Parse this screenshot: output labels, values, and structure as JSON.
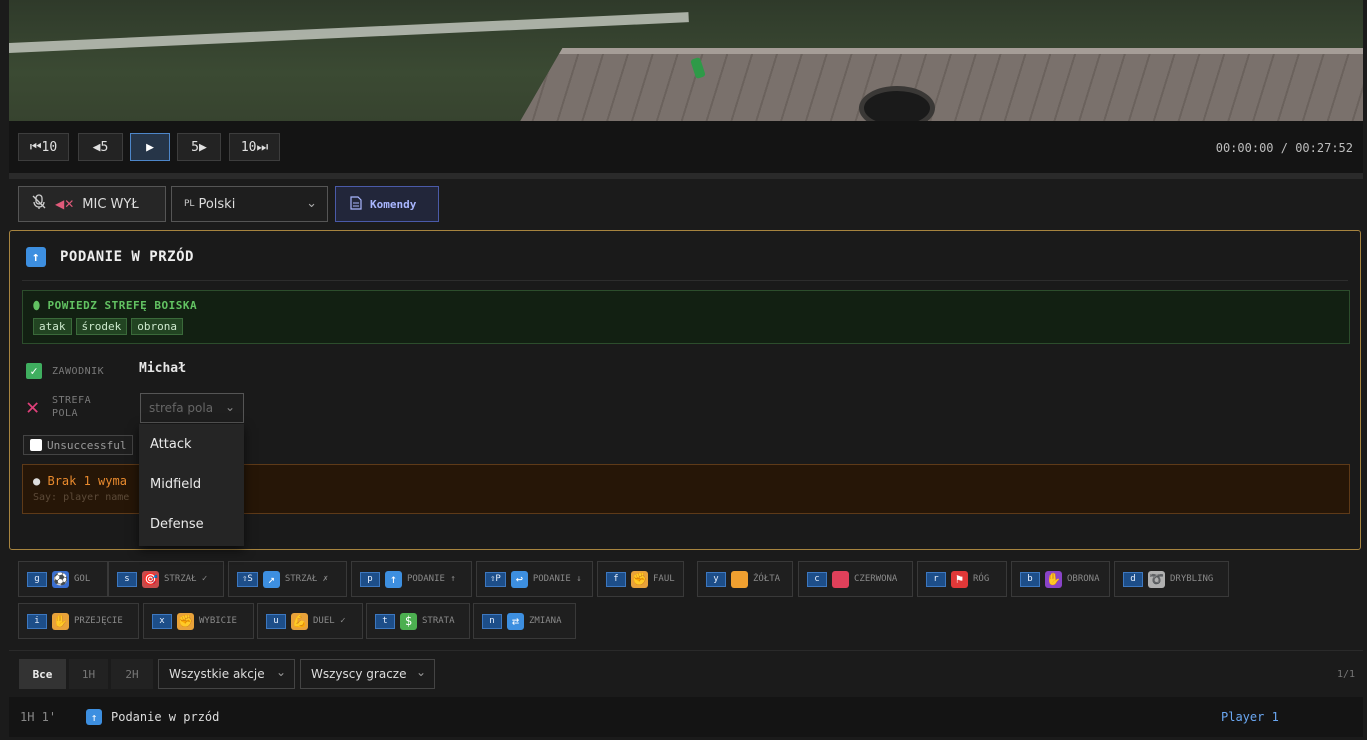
{
  "controls": {
    "back10": "⏮10",
    "back5": "◀5",
    "play": "▶",
    "fwd5": "5▶",
    "fwd10": "10⏭",
    "timecode": "00:00:00 / 00:27:52"
  },
  "toolbar": {
    "mic_label": "MIC WYŁ",
    "lang_code": "PL",
    "lang_value": "Polski",
    "commands_label": "Komendy"
  },
  "action_panel": {
    "title": "PODANIE W PRZÓD",
    "hint_title": "POWIEDZ STREFĘ BOISKA",
    "hint_chips": [
      "atak",
      "środek",
      "obrona"
    ],
    "player_label": "ZAWODNIK",
    "player_value": "Michał",
    "zone_label_1": "STREFA",
    "zone_label_2": "POLA",
    "zone_placeholder": "strefa pola",
    "unsuccessful_label": "Unsuccessful",
    "warning_title": "Brak 1 wyma",
    "warning_sub": "Say: player name",
    "warning_sub_tail": "ne"
  },
  "zone_dropdown": {
    "options": [
      "Attack",
      "Midfield",
      "Defense"
    ]
  },
  "action_keys": [
    {
      "key": "g",
      "label": "GOL",
      "icon": "soccer-ball-icon",
      "emoji": "⚽",
      "color": "#3a6fd1"
    },
    {
      "key": "s",
      "label": "STRZAŁ ✓",
      "icon": "target-icon",
      "emoji": "🎯",
      "color": "#c94a4a"
    },
    {
      "key": "⇧S",
      "label": "STRZAŁ ✗",
      "icon": "arrow-up-right-icon",
      "emoji": "↗",
      "color": "#3d8fe0"
    },
    {
      "key": "p",
      "label": "PODANIE ↑",
      "icon": "arrow-up-icon",
      "emoji": "↑",
      "color": "#3d8fe0"
    },
    {
      "key": "⇧P",
      "label": "PODANIE ↓",
      "icon": "return-arrow-icon",
      "emoji": "↩",
      "color": "#3d8fe0"
    },
    {
      "key": "f",
      "label": "FAUL",
      "icon": "fist-icon",
      "emoji": "✊",
      "color": "#e8a23a"
    },
    {
      "key": "y",
      "label": "ŻÓŁTA",
      "icon": "yellow-card-icon",
      "emoji": "",
      "color": "#f0a030"
    },
    {
      "key": "c",
      "label": "CZERWONA",
      "icon": "red-card-icon",
      "emoji": "",
      "color": "#e0405a"
    },
    {
      "key": "r",
      "label": "RÓG",
      "icon": "corner-flag-icon",
      "emoji": "⚑",
      "color": "#e03838"
    },
    {
      "key": "b",
      "label": "OBRONA",
      "icon": "glove-icon",
      "emoji": "✋",
      "color": "#8a44c8"
    },
    {
      "key": "d",
      "label": "DRYBLING",
      "icon": "dribble-icon",
      "emoji": "➰",
      "color": "#b0b0b0"
    },
    {
      "key": "i",
      "label": "PRZEJĘCIE",
      "icon": "hand-icon",
      "emoji": "✋",
      "color": "#e8a23a"
    },
    {
      "key": "x",
      "label": "WYBICIE",
      "icon": "punch-icon",
      "emoji": "✊",
      "color": "#e8a23a"
    },
    {
      "key": "u",
      "label": "DUEL ✓",
      "icon": "flexed-arm-icon",
      "emoji": "💪",
      "color": "#e8a23a"
    },
    {
      "key": "t",
      "label": "STRATA",
      "icon": "money-wings-icon",
      "emoji": "$",
      "color": "#4caf50"
    },
    {
      "key": "n",
      "label": "ZMIANA",
      "icon": "swap-icon",
      "emoji": "⇄",
      "color": "#3d8fe0"
    }
  ],
  "filters": {
    "tabs": [
      "Все",
      "1H",
      "2H"
    ],
    "actions_select": "Wszystkie akcje",
    "players_select": "Wszyscy gracze",
    "pager": "1/1"
  },
  "event_row": {
    "time": "1H 1'",
    "label": "Podanie w przód",
    "player": "Player 1"
  }
}
